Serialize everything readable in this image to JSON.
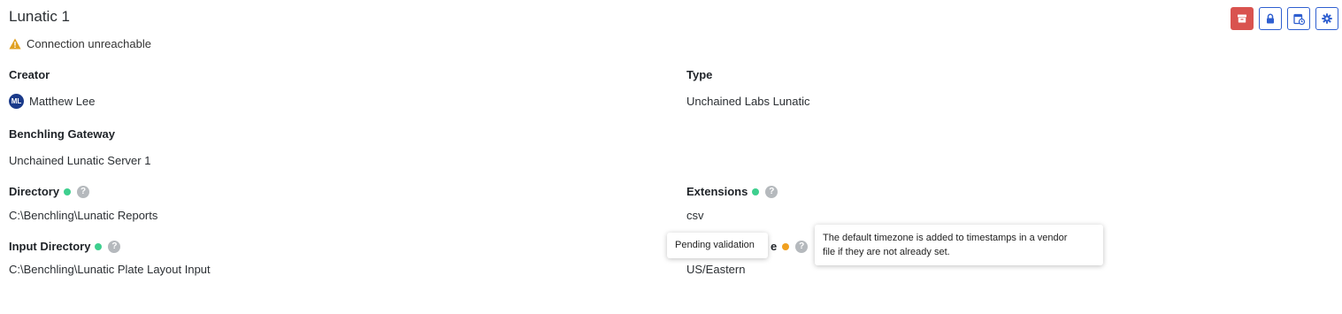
{
  "header": {
    "title": "Lunatic 1",
    "status_text": "Connection unreachable",
    "warning_color": "#e0a020"
  },
  "toolbar": {
    "buttons": [
      {
        "icon": "archive-icon",
        "color": "#d9534f"
      },
      {
        "icon": "lock-icon"
      },
      {
        "icon": "schedule-icon"
      },
      {
        "icon": "gear-icon"
      }
    ]
  },
  "fields": {
    "creator": {
      "label": "Creator",
      "avatar_initials": "ML",
      "value": "Matthew Lee"
    },
    "type": {
      "label": "Type",
      "value": "Unchained Labs Lunatic"
    },
    "gateway": {
      "label": "Benchling Gateway",
      "value": "Unchained Lunatic Server 1"
    },
    "directory": {
      "label": "Directory",
      "value": "C:\\Benchling\\Lunatic Reports",
      "help": "?"
    },
    "extensions": {
      "label": "Extensions",
      "value": "csv",
      "help": "?"
    },
    "input_directory": {
      "label": "Input Directory",
      "value": "C:\\Benchling\\Lunatic Plate Layout Input",
      "help": "?"
    },
    "timezone": {
      "label_fragment": "e",
      "value": "US/Eastern",
      "help": "?"
    }
  },
  "tooltips": {
    "pending": "Pending validation",
    "timezone_line1": "The default timezone is added to timestamps in a vendor",
    "timezone_line2": "file if they are not already set."
  }
}
